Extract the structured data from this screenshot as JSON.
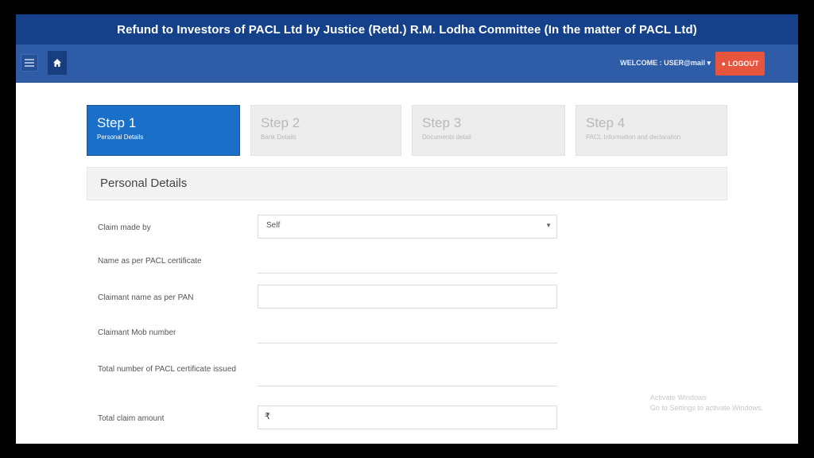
{
  "header": {
    "banner_title": "Refund to Investors of PACL Ltd by Justice (Retd.) R.M. Lodha Committee (In the matter of PACL Ltd)"
  },
  "navbar": {
    "welcome_text": "WELCOME : USER@mail",
    "logout_label": "LOGOUT"
  },
  "steps": [
    {
      "title": "Step 1",
      "subtitle": "Personal Details"
    },
    {
      "title": "Step 2",
      "subtitle": "Bank Details"
    },
    {
      "title": "Step 3",
      "subtitle": "Documents detail"
    },
    {
      "title": "Step 4",
      "subtitle": "PACL Information and declaration"
    }
  ],
  "panel": {
    "title": "Personal Details"
  },
  "form": {
    "claim_made_by": {
      "label": "Claim made by",
      "value": "Self"
    },
    "name_certificate": {
      "label": "Name as per PACL certificate",
      "value": ""
    },
    "claimant_name_pan": {
      "label": "Claimant name as per PAN",
      "value": ""
    },
    "claimant_mobile": {
      "label": "Claimant Mob number",
      "value": ""
    },
    "total_certificates": {
      "label": "Total number of PACL certificate issued",
      "value": ""
    },
    "total_claim_amount": {
      "label": "Total claim amount",
      "currency": "₹",
      "value": ""
    }
  },
  "watermark": {
    "line1": "Activate Windows",
    "line2": "Go to Settings to activate Windows."
  },
  "colors": {
    "banner": "#15418a",
    "navbar": "#2e5ca7",
    "active_step": "#1a6fc8",
    "logout": "#e8553e"
  }
}
